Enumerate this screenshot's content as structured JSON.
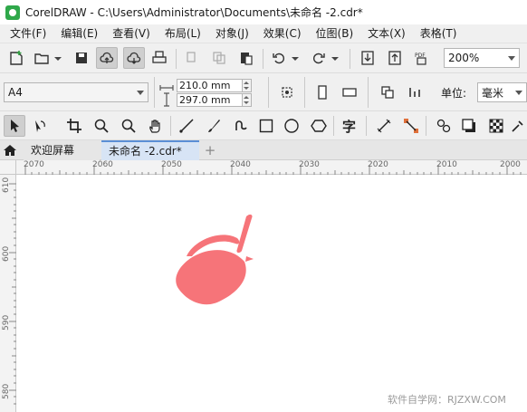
{
  "window": {
    "title": "CorelDRAW - C:\\Users\\Administrator\\Documents\\未命名 -2.cdr*"
  },
  "menu": {
    "items": [
      "文件(F)",
      "编辑(E)",
      "查看(V)",
      "布局(L)",
      "对象(J)",
      "效果(C)",
      "位图(B)",
      "文本(X)",
      "表格(T)"
    ]
  },
  "standard_toolbar": {
    "zoom_value": "200%"
  },
  "property_bar": {
    "page_size": "A4",
    "width_value": "210.0 mm",
    "height_value": "297.0 mm",
    "units_label": "单位:",
    "units_value": "毫米"
  },
  "tabs": {
    "welcome": "欢迎屏幕",
    "document": "未命名 -2.cdr*",
    "add": "+"
  },
  "rulers": {
    "horizontal": [
      "2070",
      "2060",
      "2050",
      "2040",
      "2030",
      "2020",
      "2010",
      "2000"
    ],
    "vertical": [
      "610",
      "600",
      "590",
      "580"
    ]
  },
  "canvas": {
    "shape_color": "#f67479"
  },
  "watermark": "软件自学网：RJZXW.COM"
}
